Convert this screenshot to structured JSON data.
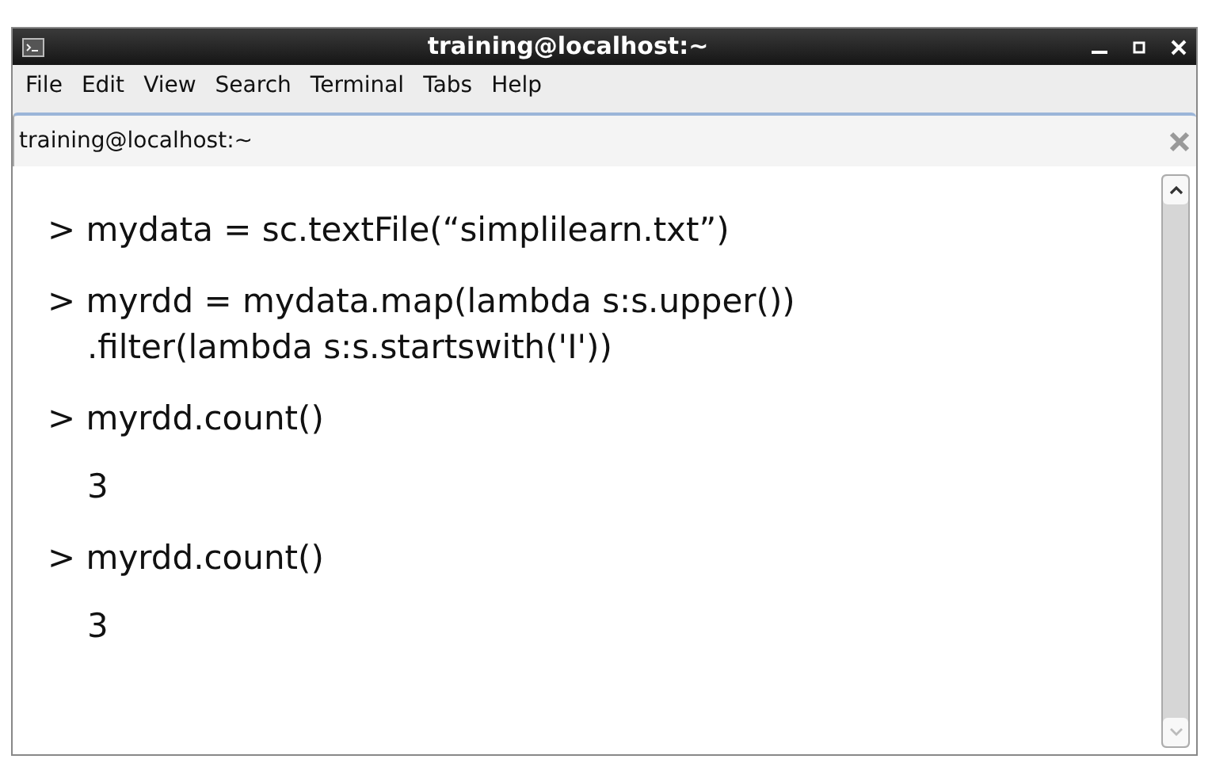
{
  "window": {
    "title": "training@localhost:~"
  },
  "menu": [
    "File",
    "Edit",
    "View",
    "Search",
    "Terminal",
    "Tabs",
    "Help"
  ],
  "tab": {
    "label": "training@localhost:~"
  },
  "terminal_lines": [
    {
      "kind": "command",
      "text": "> mydata = sc.textFile(“simplilearn.txt”)"
    },
    {
      "kind": "command",
      "text": "> myrdd = mydata.map(lambda s:s.upper())"
    },
    {
      "kind": "continuation",
      "text": ".filter(lambda s:s.startswith('I'))"
    },
    {
      "kind": "command",
      "text": "> myrdd.count()"
    },
    {
      "kind": "output",
      "text": "3"
    },
    {
      "kind": "command",
      "text": "> myrdd.count()"
    },
    {
      "kind": "output",
      "text": "3"
    }
  ]
}
